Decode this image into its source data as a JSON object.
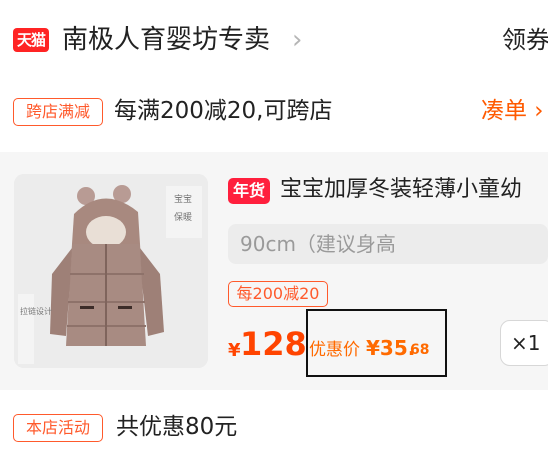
{
  "store": {
    "platform_badge": "天猫",
    "name": "南极人育婴坊专卖",
    "coupon_label": "领券"
  },
  "promotion": {
    "tag": "跨店满减",
    "text": "每满200减20,可跨店",
    "action": "凑单"
  },
  "product": {
    "image_text": [
      "宝宝",
      "保暖",
      "拉链设计"
    ],
    "badge": "年货",
    "title": "宝宝加厚冬装轻薄小童幼",
    "sku": "90cm（建议身高",
    "discount_tag": "每200减20",
    "price_symbol": "¥",
    "price": "128",
    "promo_price_label": "优惠价",
    "promo_price_symbol": "¥",
    "promo_price_int": "35.",
    "promo_price_dec": "68",
    "quantity": "×1"
  },
  "store_activity": {
    "tag": "本店活动",
    "text": "共优惠80元"
  },
  "colors": {
    "accent": "#ff4400",
    "tag_orange": "#ff5a2c",
    "tmall_red": "#ff2424",
    "badge_red": "#ff1f3d"
  }
}
